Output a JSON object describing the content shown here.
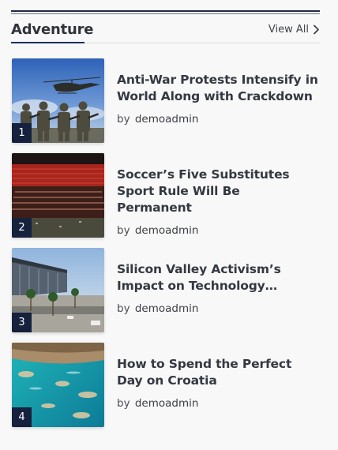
{
  "widget": {
    "title": "Adventure",
    "view_all_label": "View All",
    "colors": {
      "accent": "#15305e",
      "badge_bg": "#15213d",
      "rule": "#1f2a44"
    }
  },
  "posts": [
    {
      "rank": "1",
      "title": "Anti-War Protests Intensify in World Along with Crackdown",
      "by_label": "by",
      "author": "demoadmin",
      "image_subject": "soldiers-with-helicopter"
    },
    {
      "rank": "2",
      "title": "Soccer’s Five Substitutes Sport Rule Will Be Permanent",
      "by_label": "by",
      "author": "demoadmin",
      "image_subject": "stadium-stands"
    },
    {
      "rank": "3",
      "title": "Silicon Valley Activism’s Impact on Technology…",
      "by_label": "by",
      "author": "demoadmin",
      "image_subject": "modern-building-with-palms"
    },
    {
      "rank": "4",
      "title": "How to Spend the Perfect Day on Croatia",
      "by_label": "by",
      "author": "demoadmin",
      "image_subject": "turquoise-sea-rocks"
    }
  ]
}
